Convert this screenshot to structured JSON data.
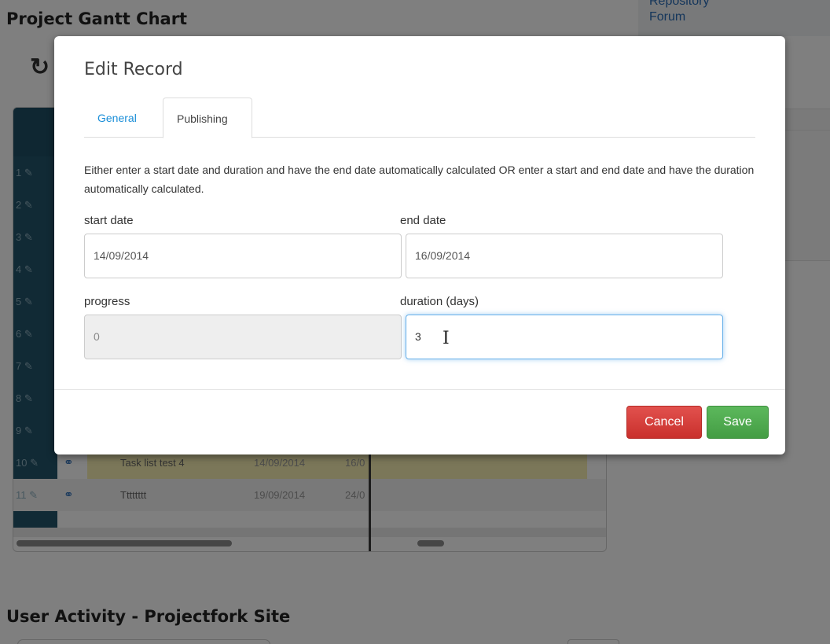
{
  "background": {
    "page_title": "Project Gantt Chart",
    "side_links": [
      "Repository",
      "Forum"
    ],
    "gantt_rows": [
      {
        "num": "1",
        "name": "",
        "start": "",
        "end": ""
      },
      {
        "num": "2",
        "name": "",
        "start": "",
        "end": ""
      },
      {
        "num": "3",
        "name": "",
        "start": "",
        "end": ""
      },
      {
        "num": "4",
        "name": "",
        "start": "",
        "end": ""
      },
      {
        "num": "5",
        "name": "",
        "start": "",
        "end": ""
      },
      {
        "num": "6",
        "name": "",
        "start": "",
        "end": ""
      },
      {
        "num": "7",
        "name": "",
        "start": "",
        "end": ""
      },
      {
        "num": "8",
        "name": "",
        "start": "",
        "end": ""
      },
      {
        "num": "9",
        "name": "",
        "start": "",
        "end": ""
      },
      {
        "num": "10",
        "name": "Task list test 4",
        "start": "14/09/2014",
        "end": "16/0"
      },
      {
        "num": "11",
        "name": "Tttttttt",
        "start": "19/09/2014",
        "end": "24/0"
      }
    ],
    "activity_title": "User Activity - Projectfork Site"
  },
  "modal": {
    "title": "Edit Record",
    "tabs": [
      {
        "label": "General",
        "active": false
      },
      {
        "label": "Publishing",
        "active": true
      }
    ],
    "help_text": "Either enter a start date and duration and have the end date automatically calculated OR enter a start and end date and have the duration automatically calculated.",
    "fields": {
      "start_date": {
        "label": "start date",
        "value": "14/09/2014"
      },
      "end_date": {
        "label": "end date",
        "value": "16/09/2014"
      },
      "progress": {
        "label": "progress",
        "value": "0",
        "disabled": true
      },
      "duration": {
        "label": "duration (days)",
        "value": "3",
        "focused": true
      }
    },
    "buttons": {
      "cancel": "Cancel",
      "save": "Save"
    }
  },
  "colors": {
    "tab_active_link": "#1a8ed8",
    "cancel": "#d9534f",
    "save": "#5cb85c",
    "focus_border": "#66afe9"
  }
}
